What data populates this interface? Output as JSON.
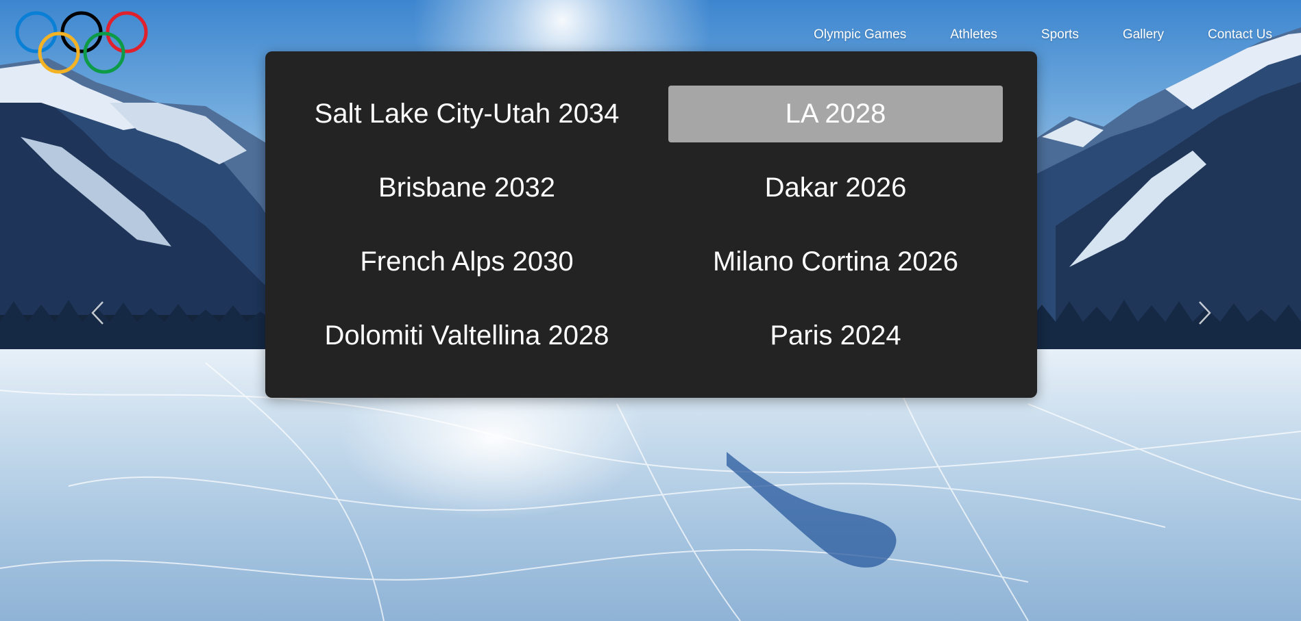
{
  "nav": {
    "links": [
      {
        "label": "Olympic Games"
      },
      {
        "label": "Athletes"
      },
      {
        "label": "Sports"
      },
      {
        "label": "Gallery"
      },
      {
        "label": "Contact Us"
      }
    ]
  },
  "logo": {
    "icon": "olympic-rings",
    "ring_colors": [
      "#0a7fd6",
      "#000000",
      "#e0212d",
      "#f4b324",
      "#0e9b48"
    ]
  },
  "carousel": {
    "prev_icon": "chevron-left-icon",
    "next_icon": "chevron-right-icon"
  },
  "games_menu": {
    "items": [
      {
        "label": "Salt Lake City-Utah 2034",
        "active": false
      },
      {
        "label": "LA 2028",
        "active": true
      },
      {
        "label": "Brisbane 2032",
        "active": false
      },
      {
        "label": "Dakar 2026",
        "active": false
      },
      {
        "label": "French Alps 2030",
        "active": false
      },
      {
        "label": "Milano Cortina 2026",
        "active": false
      },
      {
        "label": "Dolomiti Valtellina 2028",
        "active": false
      },
      {
        "label": "Paris 2024",
        "active": false
      }
    ],
    "active_color": "#a6a6a6",
    "panel_color": "#232323"
  }
}
